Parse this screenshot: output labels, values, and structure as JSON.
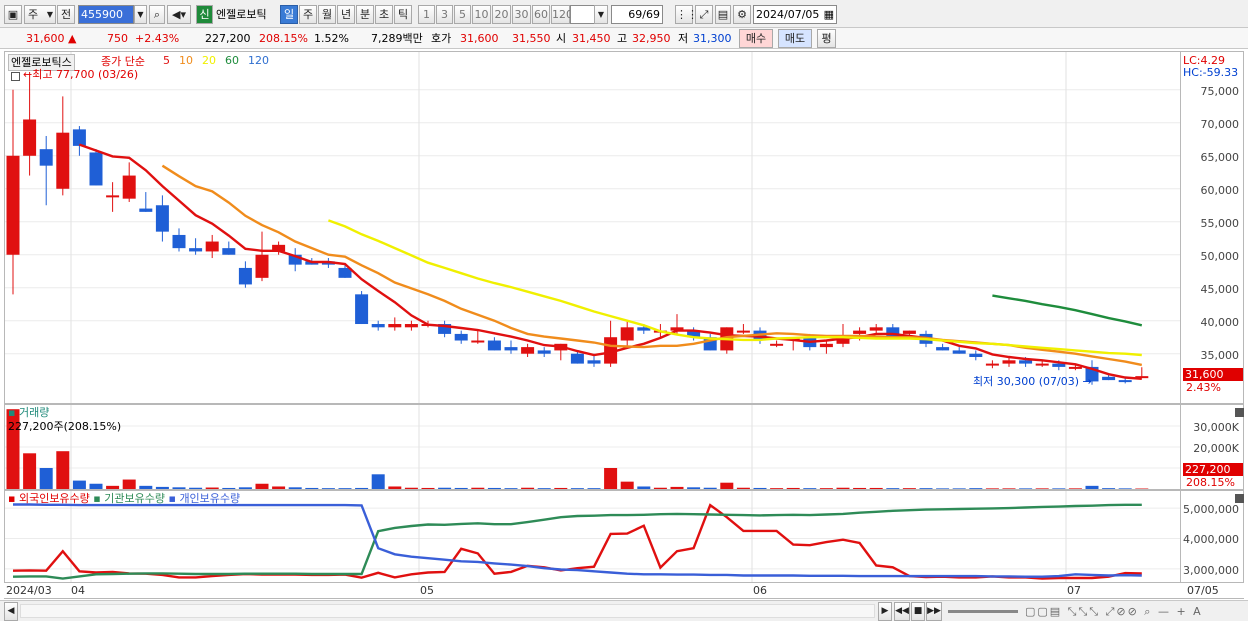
{
  "toolbar": {
    "period_week": "주",
    "prev_label": "전",
    "code_value": "455900",
    "new_badge": "신",
    "stock_name": "엔젤로보틱",
    "periods": [
      "일",
      "주",
      "월",
      "년",
      "분",
      "초",
      "틱"
    ],
    "active_period": "일",
    "intervals": [
      "1",
      "3",
      "5",
      "10",
      "20",
      "30",
      "60",
      "120"
    ],
    "count_value": "69/69",
    "date_value": "2024/07/05"
  },
  "quote": {
    "price": "31,600",
    "change": "750",
    "change_pct": "+2.43%",
    "volume": "227,200",
    "volume_ratio": "208.15%",
    "turnover": "1.52%",
    "amount": "7,289백만",
    "bid_label": "호가",
    "ask_price": "31,600",
    "bid_price": "31,550",
    "open_label": "시",
    "open": "31,450",
    "high_label": "고",
    "high": "32,950",
    "low_label": "저",
    "low": "31,300",
    "buy_button": "매수",
    "sell_button": "매도",
    "eval_button": "평"
  },
  "price_panel": {
    "name_tag": "엔젤로보틱스",
    "ma_label": "종가 단순",
    "ma_periods": [
      "5",
      "10",
      "20",
      "60",
      "120"
    ],
    "ma_colors": [
      "#e01010",
      "#f08c1c",
      "#f0f000",
      "#1e8c3c",
      "#2f6fd0"
    ],
    "max_note": "최고 77,700 (03/26)",
    "min_note": "최저 30,300 (07/03)",
    "lc": "LC:4.29",
    "hc": "HC:-59.33",
    "ticks": [
      "75,000",
      "70,000",
      "65,000",
      "60,000",
      "55,000",
      "50,000",
      "45,000",
      "40,000",
      "35,000"
    ],
    "last_tag": "31,600",
    "last_pct": "2.43%"
  },
  "volume_panel": {
    "title": "거래량",
    "note": "227,200주(208.15%)",
    "ticks": [
      "30,000K",
      "20,000K",
      "10,000K"
    ],
    "last_tag": "227,200",
    "last_pct": "208.15%"
  },
  "holding_panel": {
    "legend": [
      "외국인보유수량",
      "기관보유수량",
      "개인보유수량"
    ],
    "ticks": [
      "5,000,000",
      "4,000,000",
      "3,000,000"
    ]
  },
  "x_axis": {
    "labels": [
      "2024/03",
      "04",
      "05",
      "06",
      "07",
      "07/05"
    ]
  },
  "chart_data": [
    {
      "type": "candlestick",
      "title": "엔젤로보틱스",
      "ylim": [
        29500,
        78000
      ],
      "candles_ohlc": [
        [
          50000,
          75000,
          44000,
          65000
        ],
        [
          65000,
          77700,
          62000,
          70500
        ],
        [
          66000,
          68000,
          57500,
          63500
        ],
        [
          60000,
          74000,
          59000,
          68500
        ],
        [
          69000,
          69500,
          65000,
          66500
        ],
        [
          65500,
          66000,
          60500,
          60500
        ],
        [
          59000,
          61000,
          56500,
          59000
        ],
        [
          58500,
          64000,
          58000,
          62000
        ],
        [
          57000,
          59500,
          56500,
          56500
        ],
        [
          57500,
          59000,
          52000,
          53500
        ],
        [
          53000,
          54000,
          50500,
          51000
        ],
        [
          51000,
          52500,
          50000,
          50500
        ],
        [
          50500,
          53000,
          49500,
          52000
        ],
        [
          51000,
          52000,
          50000,
          50000
        ],
        [
          48000,
          49000,
          45000,
          45500
        ],
        [
          46500,
          53500,
          46000,
          50000
        ],
        [
          50500,
          52000,
          50000,
          51500
        ],
        [
          50000,
          51000,
          47500,
          48500
        ],
        [
          49000,
          49500,
          48500,
          48500
        ],
        [
          49000,
          49500,
          48000,
          48500
        ],
        [
          48000,
          48500,
          46500,
          46500
        ],
        [
          44000,
          44500,
          39500,
          39500
        ],
        [
          39500,
          40000,
          38500,
          39000
        ],
        [
          39000,
          40500,
          38500,
          39500
        ],
        [
          39000,
          40000,
          38500,
          39500
        ],
        [
          39500,
          40000,
          39000,
          39500
        ],
        [
          39500,
          40000,
          37500,
          38000
        ],
        [
          38000,
          38500,
          36500,
          37000
        ],
        [
          37000,
          38500,
          36500,
          37000
        ],
        [
          37000,
          37500,
          35500,
          35500
        ],
        [
          36000,
          37000,
          35000,
          35500
        ],
        [
          35000,
          36500,
          34500,
          36000
        ],
        [
          35500,
          36000,
          34500,
          35000
        ],
        [
          35500,
          36500,
          34000,
          36500
        ],
        [
          35000,
          35500,
          33500,
          33500
        ],
        [
          34000,
          35000,
          33000,
          33500
        ],
        [
          33500,
          40000,
          33000,
          37500
        ],
        [
          37000,
          40000,
          36000,
          39000
        ],
        [
          39000,
          39500,
          38000,
          38500
        ],
        [
          38500,
          39500,
          37500,
          38500
        ],
        [
          38500,
          41000,
          38000,
          39000
        ],
        [
          38500,
          39000,
          37000,
          37500
        ],
        [
          37500,
          38000,
          35500,
          35500
        ],
        [
          35500,
          39000,
          35000,
          39000
        ],
        [
          38500,
          39500,
          38000,
          38500
        ],
        [
          38500,
          39000,
          36500,
          37000
        ],
        [
          36500,
          37000,
          36000,
          36500
        ],
        [
          37000,
          37500,
          35500,
          37500
        ],
        [
          37500,
          38000,
          35500,
          36000
        ],
        [
          36000,
          37000,
          35000,
          36500
        ],
        [
          36500,
          39500,
          36000,
          37500
        ],
        [
          38000,
          39000,
          37000,
          38500
        ],
        [
          38500,
          39500,
          38000,
          39000
        ],
        [
          39000,
          39500,
          37500,
          37500
        ],
        [
          38000,
          38500,
          37500,
          38500
        ],
        [
          38000,
          38500,
          36000,
          36500
        ],
        [
          36000,
          36500,
          35500,
          35500
        ],
        [
          35500,
          36000,
          35000,
          35000
        ],
        [
          35000,
          35500,
          34000,
          34500
        ],
        [
          33500,
          34000,
          32800,
          33500
        ],
        [
          33500,
          34500,
          33000,
          34000
        ],
        [
          34000,
          34500,
          33000,
          33500
        ],
        [
          33500,
          34000,
          33000,
          33500
        ],
        [
          33500,
          34000,
          32500,
          33000
        ],
        [
          33000,
          33500,
          32500,
          33000
        ],
        [
          33000,
          34000,
          30300,
          30800
        ],
        [
          31500,
          32000,
          31000,
          31000
        ],
        [
          31000,
          31500,
          30500,
          30800
        ],
        [
          31450,
          32950,
          31300,
          31600
        ]
      ],
      "series": [
        {
          "name": "5",
          "color": "#e01010",
          "values": [
            null,
            null,
            null,
            null,
            66700,
            65800,
            64900,
            64700,
            62800,
            60400,
            58200,
            56000,
            54700,
            52900,
            50900,
            50600,
            50600,
            49800,
            48900,
            48900,
            48600,
            46300,
            44500,
            42800,
            40800,
            39400,
            39200,
            38900,
            38600,
            38100,
            37600,
            37000,
            36300,
            36100,
            35400,
            34800,
            35200,
            35900,
            36500,
            37400,
            38500,
            38500,
            38200,
            37800,
            37700,
            37600,
            37300,
            37100,
            36800,
            37000,
            37300,
            37500,
            38000,
            38000,
            37700,
            37400,
            37000,
            36200,
            35800,
            34900,
            34500,
            34200,
            34000,
            33700,
            33400,
            32700,
            31900,
            31400,
            31200
          ]
        },
        {
          "name": "10",
          "color": "#f08c1c",
          "values": [
            null,
            null,
            null,
            null,
            null,
            null,
            null,
            null,
            null,
            63500,
            61900,
            60400,
            59600,
            57900,
            55900,
            54500,
            53400,
            52000,
            51000,
            50000,
            49700,
            48400,
            47200,
            45800,
            44900,
            44000,
            43000,
            41800,
            40900,
            40000,
            38900,
            38000,
            37600,
            37300,
            37000,
            36700,
            36200,
            36100,
            36000,
            36200,
            36200,
            36500,
            37000,
            37500,
            37700,
            37900,
            38100,
            38000,
            37800,
            37700,
            37700,
            37700,
            37600,
            37500,
            37500,
            37400,
            37100,
            36900,
            36700,
            36500,
            36300,
            35900,
            35600,
            35300,
            35000,
            34600,
            34200,
            33800,
            33300
          ]
        },
        {
          "name": "20",
          "color": "#f0f000",
          "values": [
            null,
            null,
            null,
            null,
            null,
            null,
            null,
            null,
            null,
            null,
            null,
            null,
            null,
            null,
            null,
            null,
            null,
            null,
            null,
            55200,
            54300,
            53100,
            52100,
            51000,
            49900,
            48800,
            48000,
            47200,
            46400,
            45700,
            45100,
            44400,
            43700,
            43000,
            42200,
            41400,
            40700,
            40000,
            39300,
            38400,
            37900,
            37500,
            37300,
            37200,
            37100,
            37100,
            37300,
            37400,
            37500,
            37500,
            37500,
            37400,
            37300,
            37300,
            37300,
            37200,
            37000,
            36800,
            36600,
            36500,
            36300,
            36100,
            35900,
            35700,
            35500,
            35300,
            35100,
            35000,
            34800
          ]
        },
        {
          "name": "60",
          "color": "#1e8c3c",
          "values": [
            null,
            null,
            null,
            null,
            null,
            null,
            null,
            null,
            null,
            null,
            null,
            null,
            null,
            null,
            null,
            null,
            null,
            null,
            null,
            null,
            null,
            null,
            null,
            null,
            null,
            null,
            null,
            null,
            null,
            null,
            null,
            null,
            null,
            null,
            null,
            null,
            null,
            null,
            null,
            null,
            null,
            null,
            null,
            null,
            null,
            null,
            null,
            null,
            null,
            null,
            null,
            null,
            null,
            null,
            null,
            null,
            null,
            null,
            null,
            43800,
            43400,
            43000,
            42500,
            42100,
            41600,
            41000,
            40400,
            39900,
            39300
          ]
        }
      ]
    },
    {
      "type": "bar",
      "title": "거래량",
      "ylim": [
        0,
        40000
      ],
      "values_k": [
        38000,
        17000,
        10000,
        18000,
        4000,
        2500,
        1500,
        4500,
        1500,
        1000,
        800,
        600,
        700,
        500,
        800,
        2500,
        1200,
        800,
        500,
        400,
        400,
        500,
        7000,
        1200,
        600,
        500,
        600,
        500,
        600,
        500,
        400,
        600,
        400,
        500,
        400,
        400,
        10000,
        3500,
        1200,
        600,
        1000,
        800,
        600,
        3000,
        600,
        500,
        400,
        500,
        400,
        400,
        600,
        500,
        500,
        400,
        400,
        400,
        300,
        300,
        400,
        300,
        300,
        300,
        300,
        300,
        300,
        1500,
        400,
        300,
        227
      ]
    },
    {
      "type": "line",
      "title": "보유수량",
      "ylim": [
        2600000,
        5300000
      ],
      "series": [
        {
          "name": "외국인보유수량",
          "color": "#e01010",
          "values": [
            2940000,
            2950000,
            2940000,
            3580000,
            2920000,
            2880000,
            2900000,
            2850000,
            2840000,
            2800000,
            2720000,
            2720000,
            2760000,
            2800000,
            2830000,
            2810000,
            2810000,
            2810000,
            2800000,
            2800000,
            2810000,
            2710000,
            2870000,
            2720000,
            2820000,
            2880000,
            2900000,
            3660000,
            3510000,
            2840000,
            2900000,
            3100000,
            3050000,
            2950000,
            3020000,
            3070000,
            4150000,
            4160000,
            4420000,
            3040000,
            3580000,
            3680000,
            5100000,
            4700000,
            4250000,
            4250000,
            4250000,
            3800000,
            3780000,
            3880000,
            3960000,
            3850000,
            3110000,
            3050000,
            2760000,
            2730000,
            2740000,
            2720000,
            2720000,
            2750000,
            2720000,
            2720000,
            2680000,
            2700000,
            2700000,
            2700000,
            2740000,
            2860000,
            2850000
          ]
        },
        {
          "name": "기관보유수량",
          "color": "#2e8b57",
          "values": [
            2740000,
            2750000,
            2750000,
            2680000,
            2750000,
            2820000,
            2830000,
            2840000,
            2850000,
            2850000,
            2840000,
            2830000,
            2830000,
            2830000,
            2840000,
            2840000,
            2840000,
            2840000,
            2830000,
            2830000,
            2830000,
            2830000,
            4240000,
            4350000,
            4410000,
            4460000,
            4450000,
            4480000,
            4500000,
            4470000,
            4470000,
            4540000,
            4620000,
            4700000,
            4740000,
            4750000,
            4770000,
            4770000,
            4780000,
            4800000,
            4810000,
            4800000,
            4790000,
            4780000,
            4770000,
            4760000,
            4770000,
            4780000,
            4770000,
            4790000,
            4810000,
            4850000,
            4880000,
            4910000,
            4930000,
            4950000,
            4960000,
            4970000,
            4980000,
            4990000,
            5000000,
            5020000,
            5040000,
            5050000,
            5070000,
            5080000,
            5100000,
            5110000,
            5110000
          ]
        },
        {
          "name": "개인보유수량",
          "color": "#3a5fd8",
          "values": [
            5120000,
            5120000,
            5110000,
            5110000,
            5100000,
            5100000,
            5100000,
            5100000,
            5100000,
            5100000,
            5100000,
            5100000,
            5100000,
            5100000,
            5100000,
            5100000,
            5100000,
            5100000,
            5100000,
            5100000,
            5100000,
            5090000,
            3680000,
            3480000,
            3400000,
            3350000,
            3300000,
            3250000,
            3230000,
            3180000,
            3140000,
            3090000,
            3020000,
            2980000,
            2960000,
            2920000,
            2880000,
            2840000,
            2820000,
            2820000,
            2810000,
            2810000,
            2800000,
            2800000,
            2780000,
            2780000,
            2780000,
            2780000,
            2770000,
            2770000,
            2770000,
            2760000,
            2760000,
            2760000,
            2760000,
            2760000,
            2760000,
            2760000,
            2760000,
            2750000,
            2750000,
            2740000,
            2740000,
            2760000,
            2820000,
            2800000,
            2780000,
            2790000,
            2780000
          ]
        }
      ]
    }
  ]
}
